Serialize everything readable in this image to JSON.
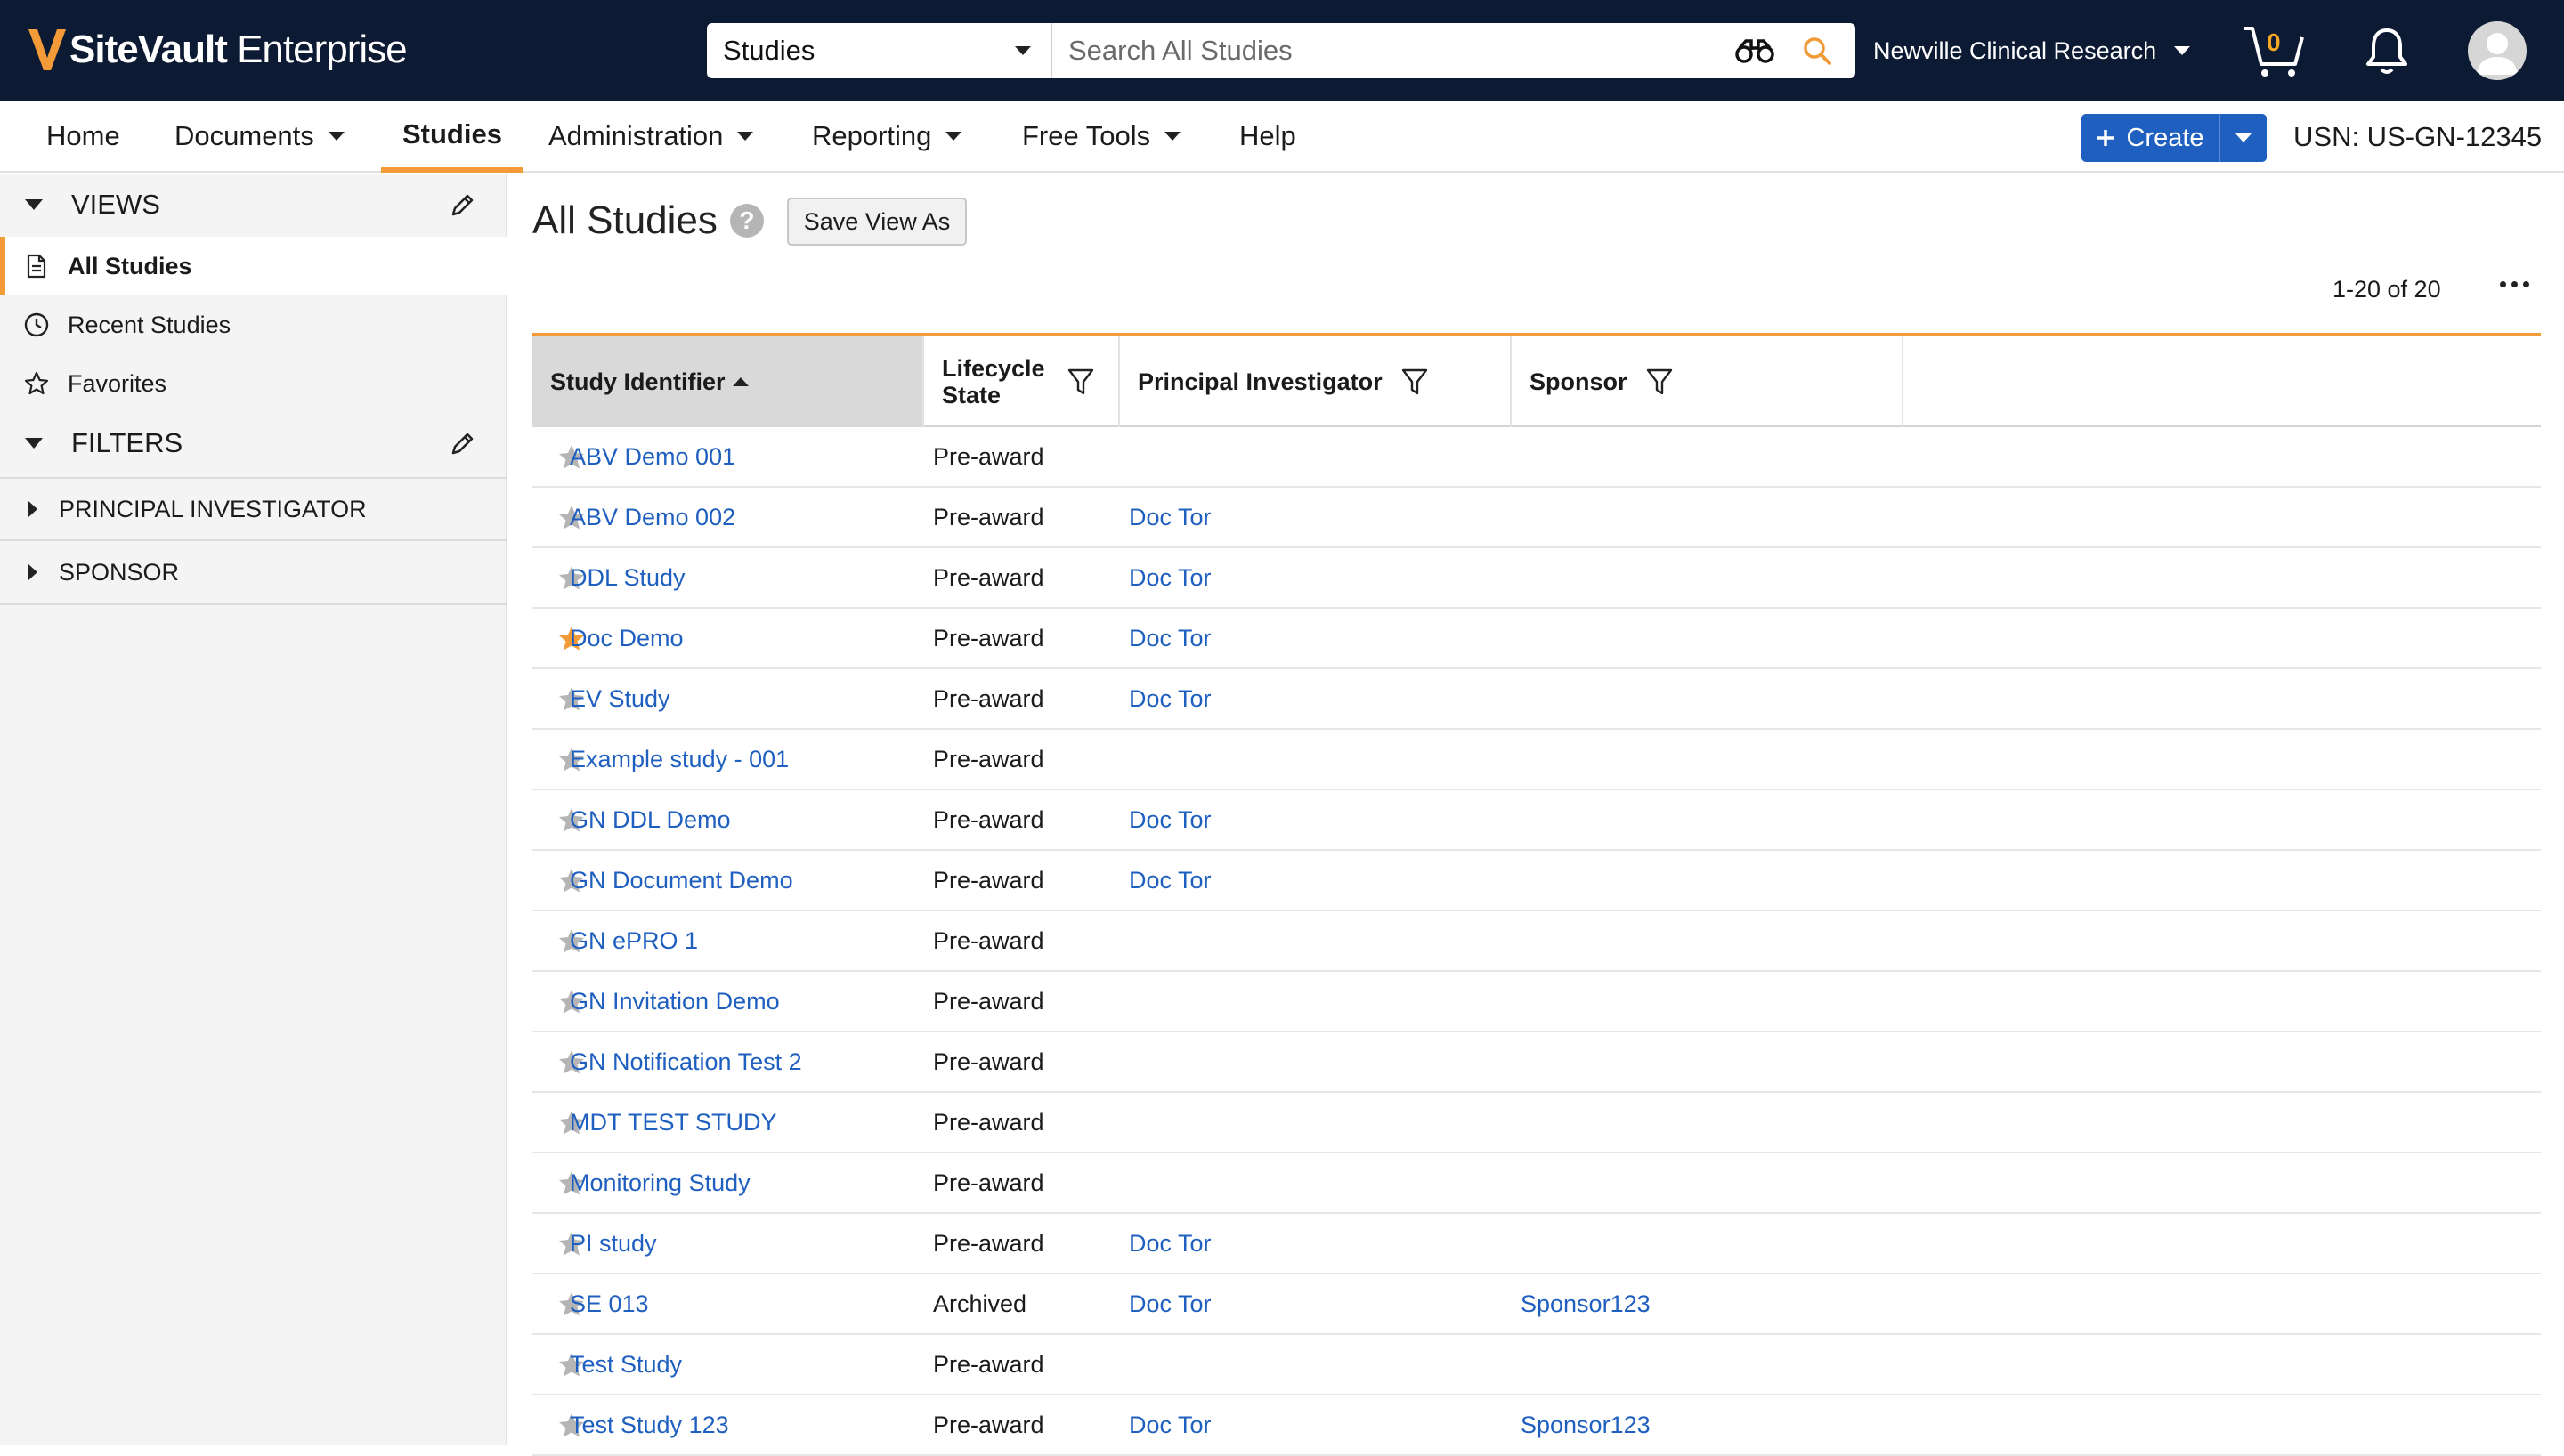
{
  "app": {
    "brand_bold": "SiteVault",
    "brand_rest": " Enterprise",
    "search_scope": "Studies",
    "search_placeholder": "Search All Studies",
    "org_name": "Newville Clinical Research",
    "cart_count": "0",
    "accent_color": "#f29b38",
    "link_color": "#1f5fbf",
    "topbar_color": "#0d1a33"
  },
  "nav": {
    "items": [
      {
        "label": "Home"
      },
      {
        "label": "Documents"
      },
      {
        "label": "Studies"
      },
      {
        "label": "Administration"
      },
      {
        "label": "Reporting"
      },
      {
        "label": "Free Tools"
      },
      {
        "label": "Help"
      }
    ],
    "create_label": "Create",
    "usn": "USN: US-GN-12345"
  },
  "sidebar": {
    "views_title": "VIEWS",
    "views": [
      {
        "label": "All Studies",
        "icon": "document-icon"
      },
      {
        "label": "Recent Studies",
        "icon": "clock-icon"
      },
      {
        "label": "Favorites",
        "icon": "star-outline-icon"
      }
    ],
    "filters_title": "FILTERS",
    "filters": [
      {
        "label": "PRINCIPAL INVESTIGATOR"
      },
      {
        "label": "SPONSOR"
      }
    ]
  },
  "main": {
    "title": "All Studies",
    "help_glyph": "?",
    "save_view_label": "Save View As",
    "pager": "1-20 of 20",
    "columns": {
      "study": "Study Identifier",
      "lifecycle": "Lifecycle State",
      "pi": "Principal Investigator",
      "sponsor": "Sponsor"
    },
    "rows": [
      {
        "study": "ABV Demo 001",
        "state": "Pre-award",
        "pi": "",
        "sponsor": "",
        "favorite": false
      },
      {
        "study": "ABV Demo 002",
        "state": "Pre-award",
        "pi": "Doc Tor",
        "sponsor": "",
        "favorite": false
      },
      {
        "study": "DDL Study",
        "state": "Pre-award",
        "pi": "Doc Tor",
        "sponsor": "",
        "favorite": false
      },
      {
        "study": "Doc Demo",
        "state": "Pre-award",
        "pi": "Doc Tor",
        "sponsor": "",
        "favorite": true
      },
      {
        "study": "EV Study",
        "state": "Pre-award",
        "pi": "Doc Tor",
        "sponsor": "",
        "favorite": false
      },
      {
        "study": "Example study - 001",
        "state": "Pre-award",
        "pi": "",
        "sponsor": "",
        "favorite": false
      },
      {
        "study": "GN DDL Demo",
        "state": "Pre-award",
        "pi": "Doc Tor",
        "sponsor": "",
        "favorite": false
      },
      {
        "study": "GN Document Demo",
        "state": "Pre-award",
        "pi": "Doc Tor",
        "sponsor": "",
        "favorite": false
      },
      {
        "study": "GN ePRO 1",
        "state": "Pre-award",
        "pi": "",
        "sponsor": "",
        "favorite": false
      },
      {
        "study": "GN Invitation Demo",
        "state": "Pre-award",
        "pi": "",
        "sponsor": "",
        "favorite": false
      },
      {
        "study": "GN Notification Test 2",
        "state": "Pre-award",
        "pi": "",
        "sponsor": "",
        "favorite": false
      },
      {
        "study": "MDT TEST STUDY",
        "state": "Pre-award",
        "pi": "",
        "sponsor": "",
        "favorite": false
      },
      {
        "study": "Monitoring Study",
        "state": "Pre-award",
        "pi": "",
        "sponsor": "",
        "favorite": false
      },
      {
        "study": "PI study",
        "state": "Pre-award",
        "pi": "Doc Tor",
        "sponsor": "",
        "favorite": false
      },
      {
        "study": "SE 013",
        "state": "Archived",
        "pi": "Doc Tor",
        "sponsor": "Sponsor123",
        "favorite": false
      },
      {
        "study": "Test Study",
        "state": "Pre-award",
        "pi": "",
        "sponsor": "",
        "favorite": false
      },
      {
        "study": "Test Study 123",
        "state": "Pre-award",
        "pi": "Doc Tor",
        "sponsor": "Sponsor123",
        "favorite": false
      }
    ]
  }
}
